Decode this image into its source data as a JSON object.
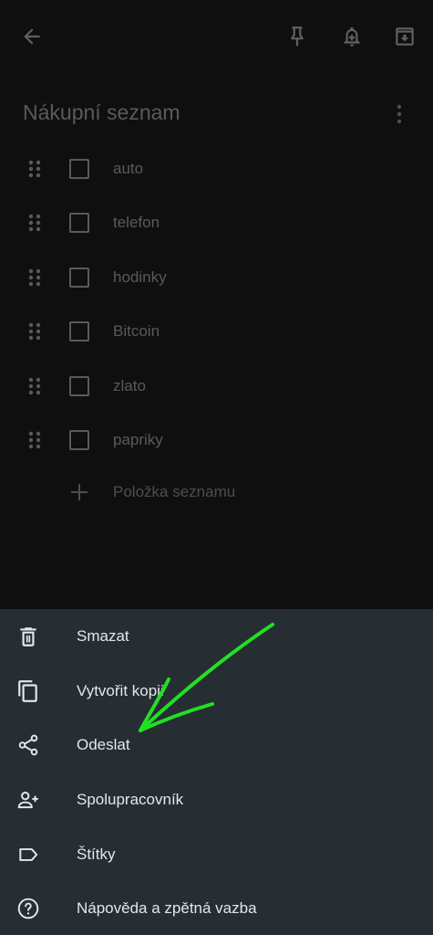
{
  "note": {
    "title": "Nákupní seznam",
    "items": [
      {
        "label": "auto"
      },
      {
        "label": "telefon"
      },
      {
        "label": "hodinky"
      },
      {
        "label": "Bitcoin"
      },
      {
        "label": "zlato"
      },
      {
        "label": "papriky"
      }
    ],
    "add_item_label": "Položka seznamu"
  },
  "menu": {
    "items": [
      {
        "label": "Smazat",
        "icon": "trash-icon"
      },
      {
        "label": "Vytvořit kopii",
        "icon": "copy-icon"
      },
      {
        "label": "Odeslat",
        "icon": "share-icon"
      },
      {
        "label": "Spolupracovník",
        "icon": "add-person-icon"
      },
      {
        "label": "Štítky",
        "icon": "label-icon"
      },
      {
        "label": "Nápověda a zpětná vazba",
        "icon": "help-icon"
      }
    ]
  },
  "colors": {
    "background": "#0f0f10",
    "sheet": "#262d33",
    "dim_text": "#5a5a5c",
    "menu_text": "#e6e7e8",
    "annotation_arrow": "#22e022"
  }
}
